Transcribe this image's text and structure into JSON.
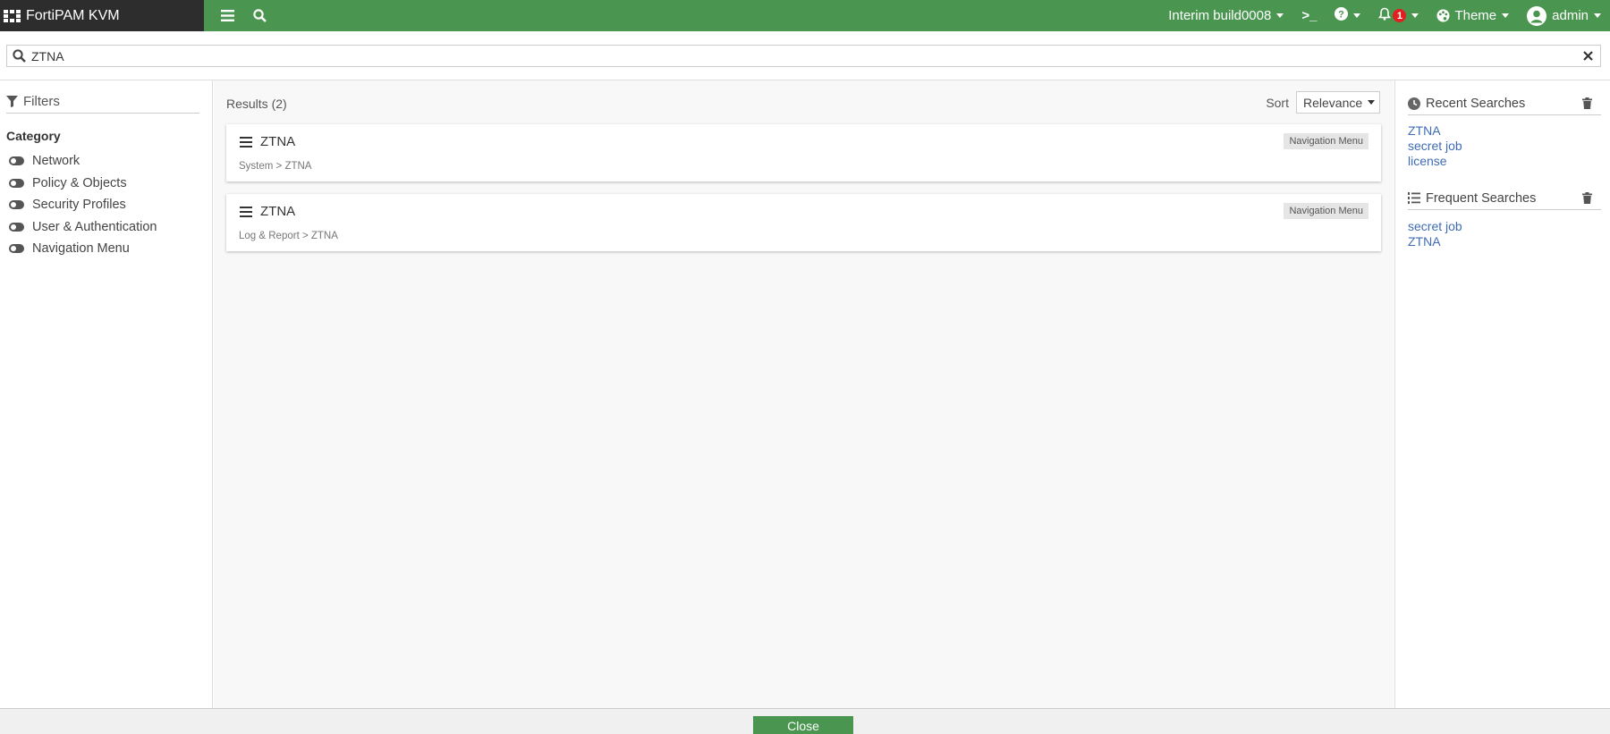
{
  "header": {
    "brand": "FortiPAM KVM",
    "build": "Interim build0008",
    "cli_symbol": ">_",
    "notification_count": "1",
    "theme_label": "Theme",
    "user_label": "admin",
    "accent_color": "#4a9650"
  },
  "search": {
    "value": "ZTNA"
  },
  "filters": {
    "title": "Filters",
    "category_title": "Category",
    "categories": [
      {
        "label": "Network"
      },
      {
        "label": "Policy & Objects"
      },
      {
        "label": "Security Profiles"
      },
      {
        "label": "User & Authentication"
      },
      {
        "label": "Navigation Menu"
      }
    ]
  },
  "results": {
    "count_label": "Results (2)",
    "sort_label": "Sort",
    "sort_value": "Relevance",
    "items": [
      {
        "title": "ZTNA",
        "path": "System > ZTNA",
        "tag": "Navigation Menu"
      },
      {
        "title": "ZTNA",
        "path": "Log & Report > ZTNA",
        "tag": "Navigation Menu"
      }
    ]
  },
  "recent": {
    "title": "Recent Searches",
    "items": [
      "ZTNA",
      "secret job",
      "license"
    ]
  },
  "frequent": {
    "title": "Frequent Searches",
    "items": [
      "secret job",
      "ZTNA"
    ]
  },
  "footer": {
    "close_label": "Close"
  }
}
